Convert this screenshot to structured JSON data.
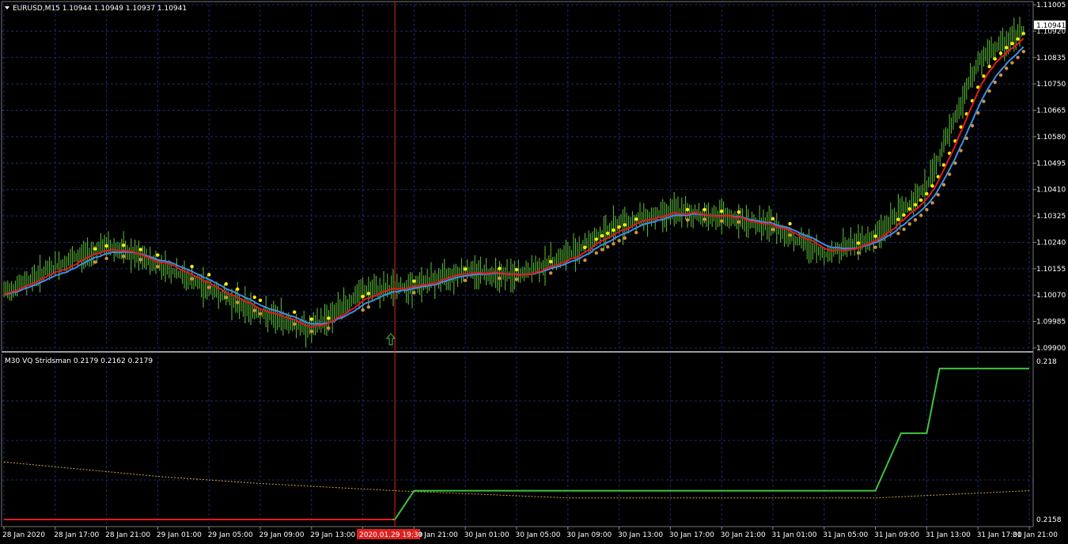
{
  "main": {
    "symbol_line": "EURUSD,M15  1.10944 1.10949 1.10937 1.10941",
    "current_price_label": "1.10941",
    "price_ticks": [
      "1.11005",
      "1.10920",
      "1.10835",
      "1.10750",
      "1.10665",
      "1.10580",
      "1.10495",
      "1.10410",
      "1.10325",
      "1.10240",
      "1.10155",
      "1.10070",
      "1.09985",
      "1.09900"
    ]
  },
  "indicator": {
    "title_line": "M30 VQ Stridsman 0.2179 0.2162 0.2179",
    "ticks": [
      "0.218",
      "0.2158"
    ]
  },
  "time_axis": {
    "labels": [
      "28 Jan 2020",
      "28 Jan 17:00",
      "28 Jan 21:00",
      "29 Jan 01:00",
      "29 Jan 05:00",
      "29 Jan 09:00",
      "29 Jan 13:00",
      "29 Jan 17:00",
      "29 Jan 21:00",
      "30 Jan 01:00",
      "30 Jan 05:00",
      "30 Jan 09:00",
      "30 Jan 13:00",
      "30 Jan 17:00",
      "30 Jan 21:00",
      "31 Jan 01:00",
      "31 Jan 05:00",
      "31 Jan 09:00",
      "31 Jan 13:00",
      "31 Jan 17:00",
      "31 Jan 21:00"
    ],
    "crosshair_label": "2020.01.29 19:30"
  },
  "colors": {
    "background": "#000000",
    "grid": "#1c2a6e",
    "bars": "#5fc43a",
    "ema_fast": "#e01b1b",
    "ema_slow": "#3d8ee8",
    "dots_upper": "#ffee00",
    "dots_lower": "#d4913a",
    "crosshair": "#e02020",
    "vq_line": "#3fc43f",
    "vq_signal": "#d4a33a",
    "arrow": "#3fa03f"
  },
  "chart_data": [
    {
      "type": "line",
      "title": "EURUSD,M15",
      "ylim": [
        1.099,
        1.11005
      ],
      "series": [
        {
          "name": "EURUSD,M15",
          "x": [
            "28 Jan 2020",
            "28 Jan 17:00",
            "28 Jan 21:00",
            "29 Jan 01:00",
            "29 Jan 05:00",
            "29 Jan 09:00",
            "29 Jan 13:00",
            "29 Jan 17:00",
            "29 Jan 21:00",
            "30 Jan 01:00",
            "30 Jan 05:00",
            "30 Jan 09:00",
            "30 Jan 13:00",
            "30 Jan 17:00",
            "30 Jan 21:00",
            "31 Jan 01:00",
            "31 Jan 05:00",
            "31 Jan 09:00",
            "31 Jan 13:00",
            "31 Jan 17:00",
            "31 Jan 21:00"
          ],
          "values": [
            1.1008,
            1.1016,
            1.1023,
            1.1017,
            1.1009,
            1.1001,
            1.0996,
            1.1008,
            1.101,
            1.1015,
            1.1013,
            1.102,
            1.103,
            1.1034,
            1.1032,
            1.1029,
            1.102,
            1.1026,
            1.1042,
            1.1082,
            1.10941
          ]
        }
      ]
    },
    {
      "type": "line",
      "title": "M30 VQ Stridsman",
      "ylim": [
        0.2158,
        0.218
      ],
      "series": [
        {
          "name": "M30 VQ Stridsman",
          "x": [
            "28 Jan 2020",
            "28 Jan 21:00",
            "29 Jan 13:00",
            "29 Jan 19:30",
            "29 Jan 21:00",
            "31 Jan 09:00",
            "31 Jan 11:00",
            "31 Jan 13:00",
            "31 Jan 14:00",
            "31 Jan 15:00",
            "31 Jan 21:00"
          ],
          "values": [
            0.2158,
            0.2158,
            0.2158,
            0.2158,
            0.2162,
            0.2162,
            0.217,
            0.217,
            0.2179,
            0.2179,
            0.2179
          ]
        },
        {
          "name": "M30 VQ Stridsman",
          "x": [
            "28 Jan 2020",
            "29 Jan 01:00",
            "29 Jan 09:00",
            "29 Jan 19:30",
            "30 Jan 09:00",
            "31 Jan 09:00",
            "31 Jan 21:00"
          ],
          "values": [
            0.2166,
            0.2164,
            0.2163,
            0.2162,
            0.2161,
            0.2161,
            0.2162
          ]
        }
      ]
    }
  ]
}
